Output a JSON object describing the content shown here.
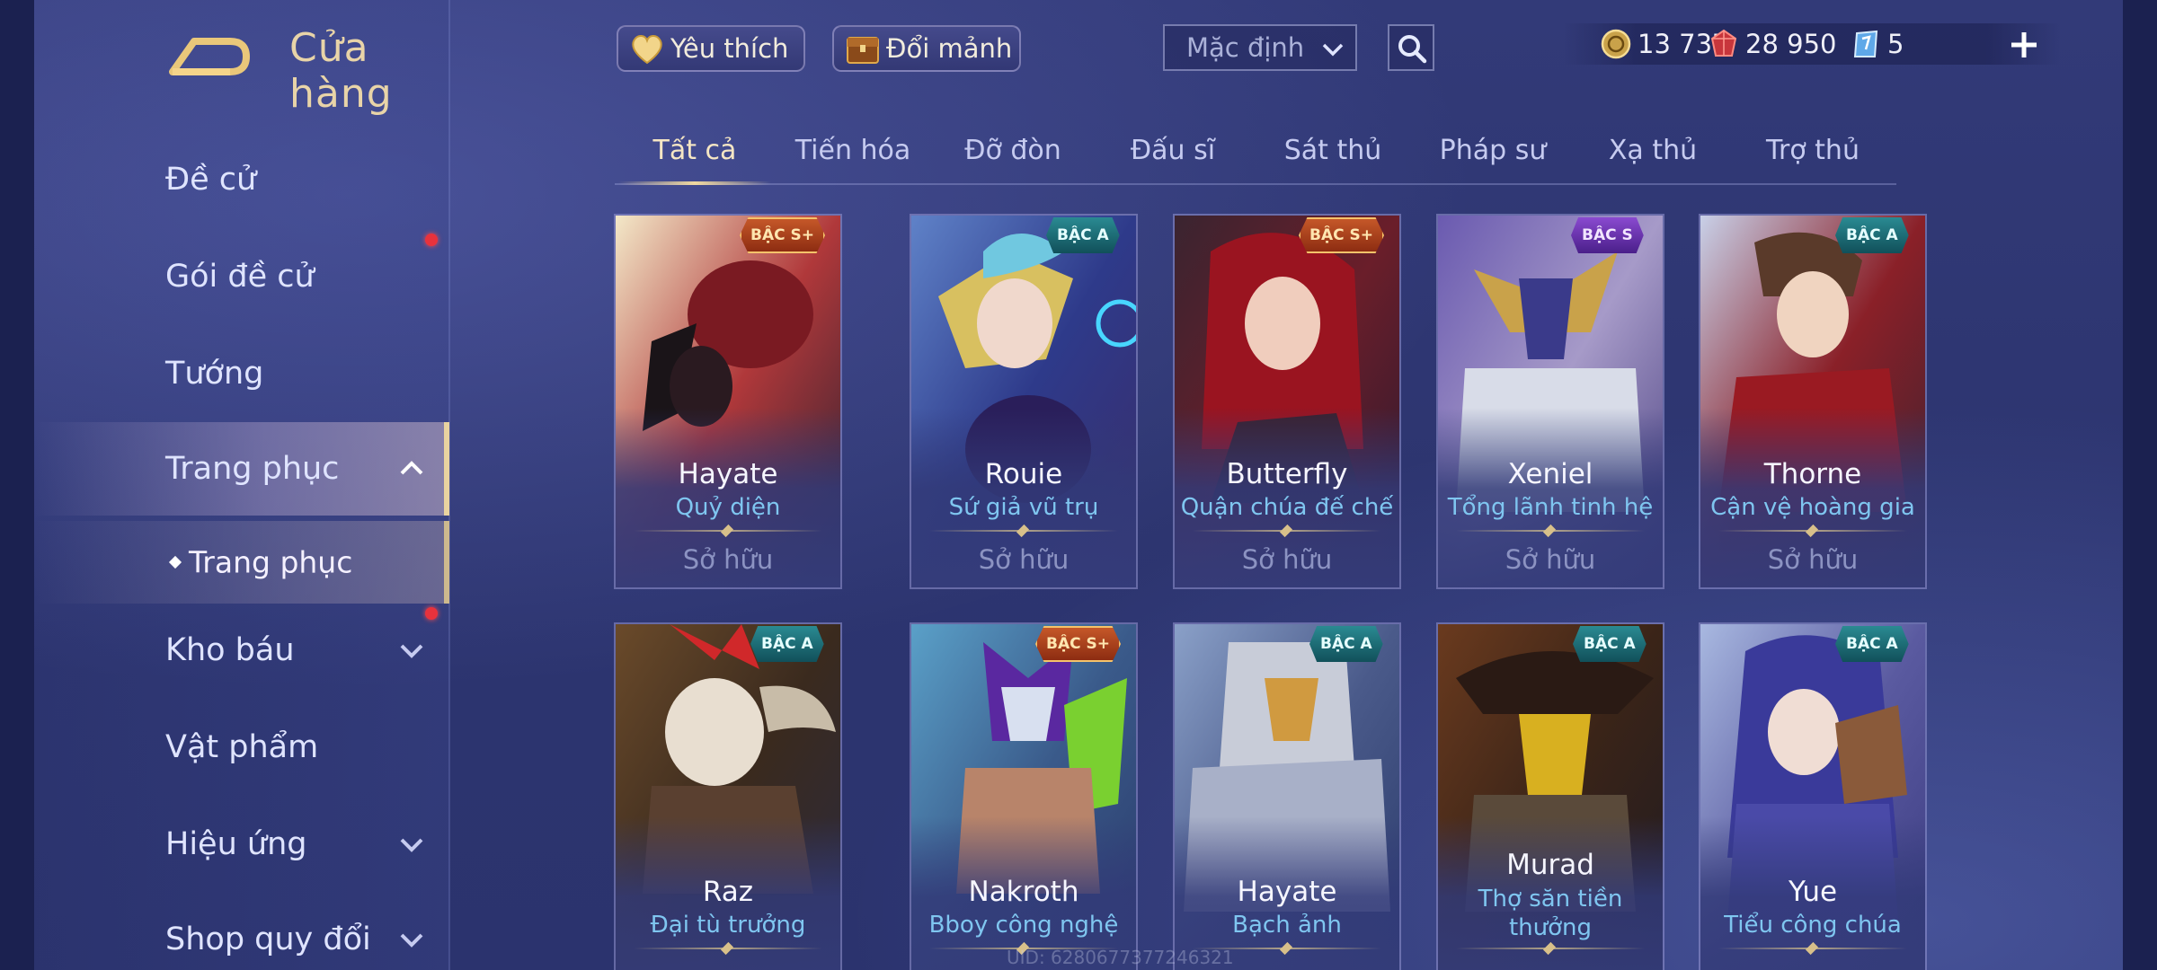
{
  "header": {
    "title": "Cửa hàng"
  },
  "toolbar": {
    "favorite_label": "Yêu thích",
    "exchange_shards_label": "Đổi mảnh",
    "sort_value": "Mặc định"
  },
  "currencies": {
    "gold": "13 737",
    "ruby": "28 950",
    "voucher": "5"
  },
  "sidebar": {
    "items": [
      {
        "label": "Đề cử"
      },
      {
        "label": "Gói đề cử"
      },
      {
        "label": "Tướng"
      },
      {
        "label": "Trang phục"
      },
      {
        "label": "Kho báu"
      },
      {
        "label": "Vật phẩm"
      },
      {
        "label": "Hiệu ứng"
      },
      {
        "label": "Shop quy đổi"
      }
    ],
    "sub_item": "Trang phục"
  },
  "tabs": [
    "Tất cả",
    "Tiến hóa",
    "Đỡ đòn",
    "Đấu sĩ",
    "Sát thủ",
    "Pháp sư",
    "Xạ thủ",
    "Trợ thủ"
  ],
  "skins": [
    {
      "hero": "Hayate",
      "skin": "Quỷ diện",
      "tier": "BẬC S+",
      "status": "Sở hữu"
    },
    {
      "hero": "Rouie",
      "skin": "Sứ giả vũ trụ",
      "tier": "BẬC A",
      "status": "Sở hữu"
    },
    {
      "hero": "Butterfly",
      "skin": "Quận chúa đế chế",
      "tier": "BẬC S+",
      "status": "Sở hữu"
    },
    {
      "hero": "Xeniel",
      "skin": "Tổng lãnh tinh hệ",
      "tier": "BẬC S",
      "status": "Sở hữu"
    },
    {
      "hero": "Thorne",
      "skin": "Cận vệ hoàng gia",
      "tier": "BẬC A",
      "status": "Sở hữu"
    },
    {
      "hero": "Raz",
      "skin": "Đại tù trưởng",
      "tier": "BẬC A"
    },
    {
      "hero": "Nakroth",
      "skin": "Bboy công nghệ",
      "tier": "BẬC S+"
    },
    {
      "hero": "Hayate",
      "skin": "Bạch ảnh",
      "tier": "BẬC A"
    },
    {
      "hero": "Murad",
      "skin": "Thợ săn tiền thưởng",
      "tier": "BẬC A"
    },
    {
      "hero": "Yue",
      "skin": "Tiểu công chúa",
      "tier": "BẬC A"
    }
  ],
  "footer": {
    "uid": "UID: 6280677377246321"
  },
  "colors": {
    "accent_gold": "#e9d3a0",
    "skin_name": "#7fc6f0",
    "notification_dot": "#e8323c"
  }
}
